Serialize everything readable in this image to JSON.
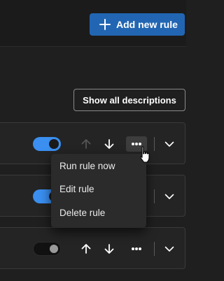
{
  "header": {
    "add_button_label": "Add new rule"
  },
  "actions": {
    "show_descriptions_label": "Show all descriptions"
  },
  "rules": [
    {
      "enabled": true,
      "move_up_enabled": false,
      "move_down_enabled": true,
      "menu_open": true
    },
    {
      "enabled": true
    },
    {
      "enabled": false,
      "move_up_enabled": true,
      "move_down_enabled": true
    }
  ],
  "context_menu": {
    "items": [
      {
        "label": "Run rule now"
      },
      {
        "label": "Edit rule"
      },
      {
        "label": "Delete rule"
      }
    ]
  },
  "colors": {
    "background": "#1f1f1f",
    "primary": "#2266b3",
    "toggle_on": "#3a8ff0",
    "card_border": "#3a3a3a",
    "menu_bg": "#2b2b2b"
  },
  "icons": [
    "plus-icon",
    "arrow-up-icon",
    "arrow-down-icon",
    "more-icon",
    "chevron-down-icon",
    "pointer-cursor-icon"
  ]
}
